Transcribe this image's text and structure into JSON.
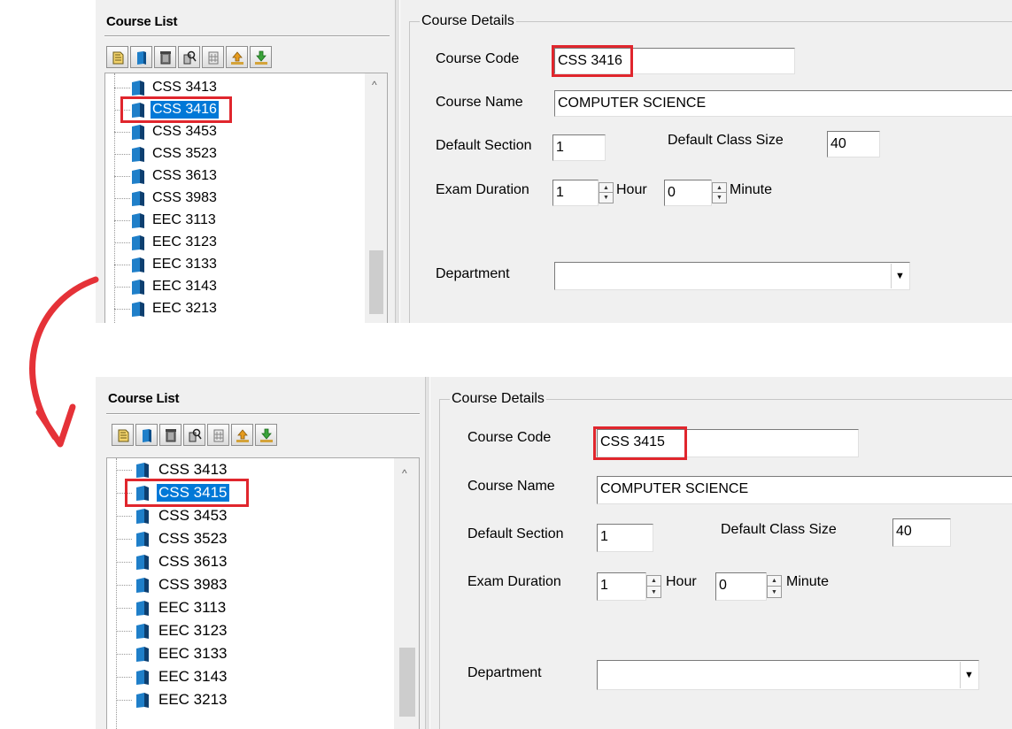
{
  "panels": [
    {
      "course_list": {
        "title": "Course List",
        "items": [
          {
            "label": "CSS 3413"
          },
          {
            "label": "CSS 3416",
            "selected": true
          },
          {
            "label": "CSS 3453"
          },
          {
            "label": "CSS 3523"
          },
          {
            "label": "CSS 3613"
          },
          {
            "label": "CSS 3983"
          },
          {
            "label": "EEC 3113"
          },
          {
            "label": "EEC 3123"
          },
          {
            "label": "EEC 3133"
          },
          {
            "label": "EEC 3143"
          },
          {
            "label": "EEC 3213"
          }
        ]
      },
      "details": {
        "group_title": "Course Details",
        "course_code_label": "Course Code",
        "course_code": "CSS 3416",
        "course_name_label": "Course Name",
        "course_name": "COMPUTER SCIENCE",
        "default_section_label": "Default Section",
        "default_section": "1",
        "default_class_size_label": "Default Class Size",
        "default_class_size": "40",
        "exam_duration_label": "Exam Duration",
        "exam_hours": "1",
        "hour_label": "Hour",
        "exam_minutes": "0",
        "minute_label": "Minute",
        "department_label": "Department",
        "department": ""
      }
    },
    {
      "course_list": {
        "title": "Course List",
        "items": [
          {
            "label": "CSS 3413"
          },
          {
            "label": "CSS 3415",
            "selected": true
          },
          {
            "label": "CSS 3453"
          },
          {
            "label": "CSS 3523"
          },
          {
            "label": "CSS 3613"
          },
          {
            "label": "CSS 3983"
          },
          {
            "label": "EEC 3113"
          },
          {
            "label": "EEC 3123"
          },
          {
            "label": "EEC 3133"
          },
          {
            "label": "EEC 3143"
          },
          {
            "label": "EEC 3213"
          }
        ]
      },
      "details": {
        "group_title": "Course Details",
        "course_code_label": "Course Code",
        "course_code": "CSS 3415",
        "course_name_label": "Course Name",
        "course_name": "COMPUTER SCIENCE",
        "default_section_label": "Default Section",
        "default_section": "1",
        "default_class_size_label": "Default Class Size",
        "default_class_size": "40",
        "exam_duration_label": "Exam Duration",
        "exam_hours": "1",
        "hour_label": "Hour",
        "exam_minutes": "0",
        "minute_label": "Minute",
        "department_label": "Department",
        "department": ""
      }
    }
  ],
  "toolbar_icons": [
    "new-course-icon",
    "book-icon",
    "delete-icon",
    "search-icon",
    "list-icon",
    "upload-icon",
    "download-icon"
  ],
  "colors": {
    "highlight": "#e0262d",
    "selection": "#0078d7",
    "arrow": "#e53238",
    "book": "#1f7fc9"
  }
}
